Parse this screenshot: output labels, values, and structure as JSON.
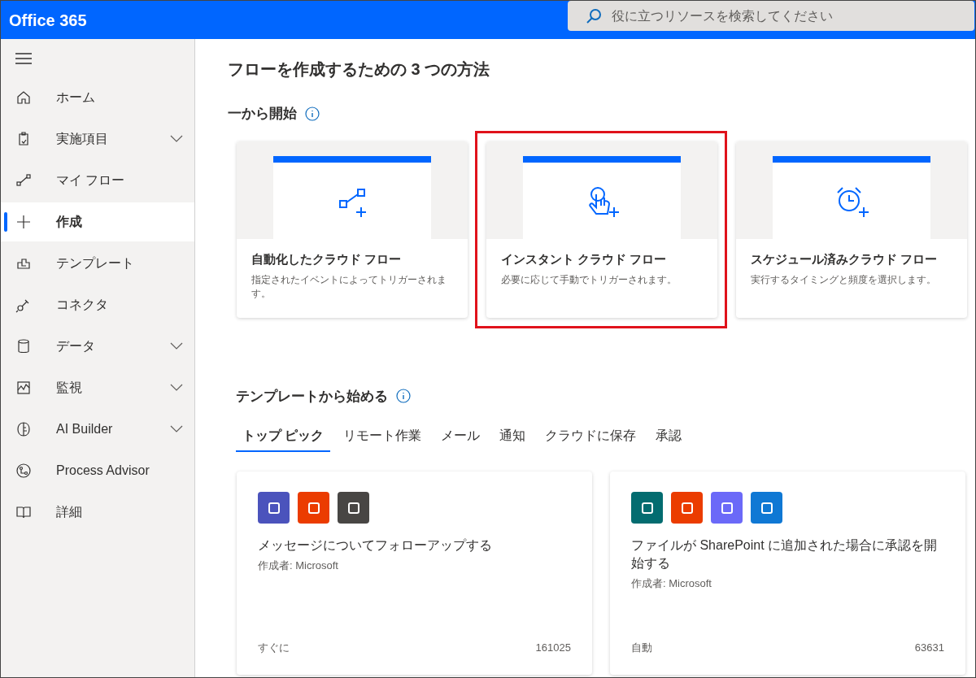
{
  "header": {
    "title": "Office 365",
    "search": {
      "placeholder": "役に立つリソースを検索してください"
    }
  },
  "sidebar": {
    "items": [
      {
        "kind": "home",
        "label": "ホーム",
        "expandable": false,
        "selected": false
      },
      {
        "kind": "clipboard",
        "label": "実施項目",
        "expandable": true,
        "selected": false
      },
      {
        "kind": "flow",
        "label": "マイ フロー",
        "expandable": false,
        "selected": false
      },
      {
        "kind": "plus",
        "label": "作成",
        "expandable": false,
        "selected": true
      },
      {
        "kind": "template",
        "label": "テンプレート",
        "expandable": false,
        "selected": false
      },
      {
        "kind": "plug",
        "label": "コネクタ",
        "expandable": false,
        "selected": false
      },
      {
        "kind": "database",
        "label": "データ",
        "expandable": true,
        "selected": false
      },
      {
        "kind": "chart",
        "label": "監視",
        "expandable": true,
        "selected": false
      },
      {
        "kind": "brain",
        "label": "AI Builder",
        "expandable": true,
        "selected": false
      },
      {
        "kind": "process",
        "label": "Process Advisor",
        "expandable": false,
        "selected": false
      },
      {
        "kind": "book",
        "label": "詳細",
        "expandable": false,
        "selected": false
      }
    ]
  },
  "main": {
    "title": "フローを作成するための 3 つの方法",
    "start_section": {
      "heading": "一から開始",
      "cards": [
        {
          "kind": "flow",
          "title": "自動化したクラウド フロー",
          "description": "指定されたイベントによってトリガーされます。",
          "highlighted": false
        },
        {
          "kind": "touch",
          "title": "インスタント クラウド フロー",
          "description": "必要に応じて手動でトリガーされます。",
          "highlighted": true
        },
        {
          "kind": "alarm",
          "title": "スケジュール済みクラウド フロー",
          "description": "実行するタイミングと頻度を選択します。",
          "highlighted": false
        }
      ]
    },
    "template_section": {
      "heading": "テンプレートから始める",
      "tabs": [
        {
          "label": "トップ ピック",
          "selected": true
        },
        {
          "label": "リモート作業",
          "selected": false
        },
        {
          "label": "メール",
          "selected": false
        },
        {
          "label": "通知",
          "selected": false
        },
        {
          "label": "クラウドに保存",
          "selected": false
        },
        {
          "label": "承認",
          "selected": false
        }
      ],
      "cards": [
        {
          "icons": [
            {
              "color": "#4b53bc"
            },
            {
              "color": "#eb3c00"
            },
            {
              "color": "#484644"
            }
          ],
          "title": "メッセージについてフォローアップする",
          "author": "作成者: Microsoft",
          "type": "すぐに",
          "count": "161025"
        },
        {
          "icons": [
            {
              "color": "#036c70"
            },
            {
              "color": "#eb3c00"
            },
            {
              "color": "#6b69f8"
            },
            {
              "color": "#0f78d4"
            }
          ],
          "title": "ファイルが SharePoint に追加された場合に承認を開始する",
          "author": "作成者: Microsoft",
          "type": "自動",
          "count": "63631"
        }
      ]
    }
  }
}
